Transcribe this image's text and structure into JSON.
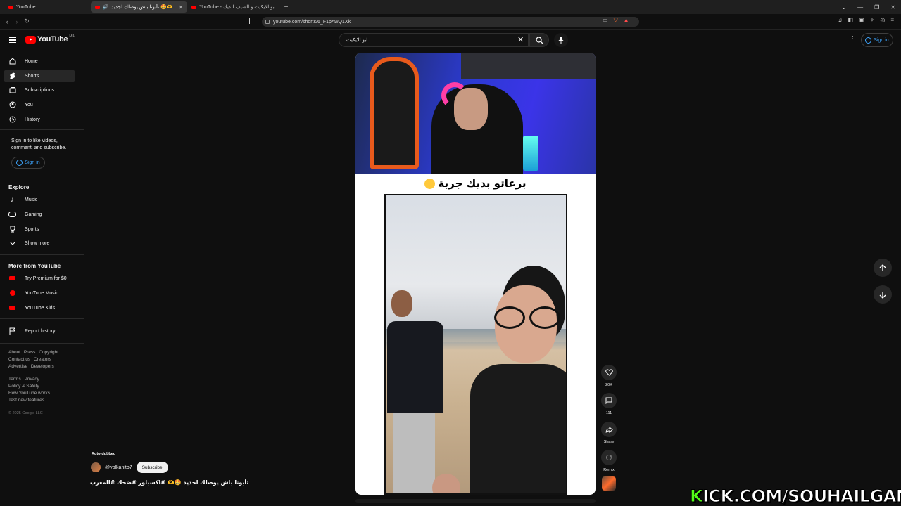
{
  "browser": {
    "tabs": [
      {
        "label": "YouTube",
        "active": false
      },
      {
        "label": "تأبونا باش يوصلك لجديد 🤩🫶",
        "active": true
      },
      {
        "label": "YouTube - ابو الايكيت و الشيف الديك",
        "active": false
      }
    ],
    "url": "youtube.com/shorts/6_F1pAwQ1Xk"
  },
  "header": {
    "logo_text": "YouTube",
    "logo_region": "MA",
    "search_value": "ابو الايكيت",
    "signin_label": "Sign in"
  },
  "sidebar": {
    "items": [
      {
        "label": "Home",
        "icon": "home-icon"
      },
      {
        "label": "Shorts",
        "icon": "shorts-icon",
        "active": true
      },
      {
        "label": "Subscriptions",
        "icon": "subscriptions-icon"
      },
      {
        "label": "You",
        "icon": "you-icon"
      },
      {
        "label": "History",
        "icon": "history-icon"
      }
    ],
    "signin_prompt": "Sign in to like videos, comment, and subscribe.",
    "signin_label": "Sign in",
    "explore_heading": "Explore",
    "explore": [
      {
        "label": "Music"
      },
      {
        "label": "Gaming"
      },
      {
        "label": "Sports"
      },
      {
        "label": "Show more"
      }
    ],
    "more_heading": "More from YouTube",
    "more": [
      {
        "label": "Try Premium for $0"
      },
      {
        "label": "YouTube Music"
      },
      {
        "label": "YouTube Kids"
      }
    ],
    "report": "Report history",
    "footer1": [
      "About",
      "Press",
      "Copyright",
      "Contact us",
      "Creators",
      "Advertise",
      "Developers"
    ],
    "footer2": [
      "Terms",
      "Privacy",
      "Policy & Safety",
      "How YouTube works",
      "Test new features"
    ],
    "copyright": "© 2025 Google LLC"
  },
  "short": {
    "caption": "برعاتو بديك جربة",
    "autodubbed": "Auto-dubbed",
    "channel": "@volkanito7",
    "subscribe": "Subscribe",
    "title": "تأبونا باش يوصلك لجديد 🤩🫶 #اكسبلور #ضحك #المغرب",
    "likes": "20K",
    "comments": "111",
    "share": "Share",
    "remix": "Remix"
  },
  "overlay": {
    "kick_k": "K",
    "kick_rest": "ICK.COM/SOUHAILGAMING"
  }
}
